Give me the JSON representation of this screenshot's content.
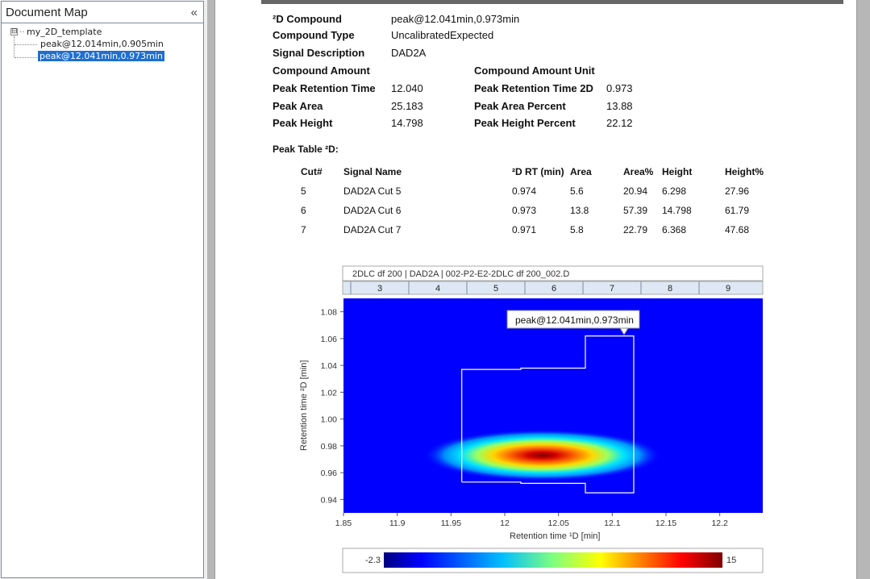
{
  "doc_map": {
    "title": "Document Map",
    "collapse_glyph": "«",
    "root_label": "my_2D_template",
    "root_toggle": "⊟",
    "items": [
      {
        "label": "peak@12.014min,0.905min",
        "selected": false
      },
      {
        "label": "peak@12.041min,0.973min",
        "selected": true
      }
    ]
  },
  "report": {
    "fields": {
      "compound_label": "²D Compound",
      "compound_value": "peak@12.041min,0.973min",
      "type_label": "Compound Type",
      "type_value": "UncalibratedExpected",
      "signal_label": "Signal Description",
      "signal_value": "DAD2A",
      "amount_label": "Compound Amount",
      "amount_unit_label": "Compound Amount Unit",
      "rt_label": "Peak Retention Time",
      "rt_value": "12.040",
      "rt2d_label": "Peak Retention Time 2D",
      "rt2d_value": "0.973",
      "area_label": "Peak Area",
      "area_value": "25.183",
      "area_pct_label": "Peak Area Percent",
      "area_pct_value": "13.88",
      "height_label": "Peak Height",
      "height_value": "14.798",
      "height_pct_label": "Peak Height Percent",
      "height_pct_value": "22.12"
    },
    "peak_table": {
      "title": "Peak Table ²D:",
      "headers": [
        "Cut#",
        "Signal Name",
        "²D RT (min)",
        "Area",
        "Area%",
        "Height",
        "Height%"
      ],
      "rows": [
        [
          "5",
          "DAD2A Cut 5",
          "0.974",
          "5.6",
          "20.94",
          "6.298",
          "27.96"
        ],
        [
          "6",
          "DAD2A Cut 6",
          "0.973",
          "13.8",
          "57.39",
          "14.798",
          "61.79"
        ],
        [
          "7",
          "DAD2A Cut 7",
          "0.971",
          "5.8",
          "22.79",
          "6.368",
          "47.68"
        ]
      ]
    }
  },
  "chart_data": {
    "type": "heatmap",
    "title": "2DLC df 200 | DAD2A | 002-P2-E2-2DLC df 200_002.D",
    "cut_labels": [
      "3",
      "4",
      "5",
      "6",
      "7",
      "8",
      "9"
    ],
    "xlabel": "Retention time ¹D [min]",
    "ylabel": "Retention time ²D [min]",
    "xlim": [
      11.85,
      12.24
    ],
    "ylim": [
      0.93,
      1.09
    ],
    "xticks": [
      11.85,
      11.9,
      11.95,
      12,
      12.05,
      12.1,
      12.15,
      12.2
    ],
    "xtick_labels": [
      "1.85",
      "11.9",
      "11.95",
      "12",
      "12.05",
      "12.1",
      "12.15",
      "12.2"
    ],
    "yticks": [
      0.94,
      0.96,
      0.98,
      1.0,
      1.02,
      1.04,
      1.06,
      1.08
    ],
    "ytick_labels": [
      "0.94",
      "0.96",
      "0.98",
      "1.00",
      "1.02",
      "1.04",
      "1.06",
      "1.08"
    ],
    "peak": {
      "x": 12.041,
      "y": 0.973,
      "z": 14.798
    },
    "peak_label": "peak@12.041min,0.973min",
    "integration_region": [
      [
        11.96,
        0.953
      ],
      [
        12.015,
        0.953
      ],
      [
        12.015,
        0.952
      ],
      [
        12.075,
        0.952
      ],
      [
        12.075,
        0.945
      ],
      [
        12.12,
        0.945
      ],
      [
        12.12,
        1.062
      ],
      [
        12.075,
        1.062
      ],
      [
        12.075,
        1.038
      ],
      [
        12.015,
        1.038
      ],
      [
        12.015,
        1.037
      ],
      [
        11.96,
        1.037
      ]
    ],
    "colorbar": {
      "min": "-2.3",
      "max": "15"
    },
    "colors": {
      "background": "#0000ff",
      "peak_core": "#8b0000",
      "region": "#ffffff"
    }
  }
}
